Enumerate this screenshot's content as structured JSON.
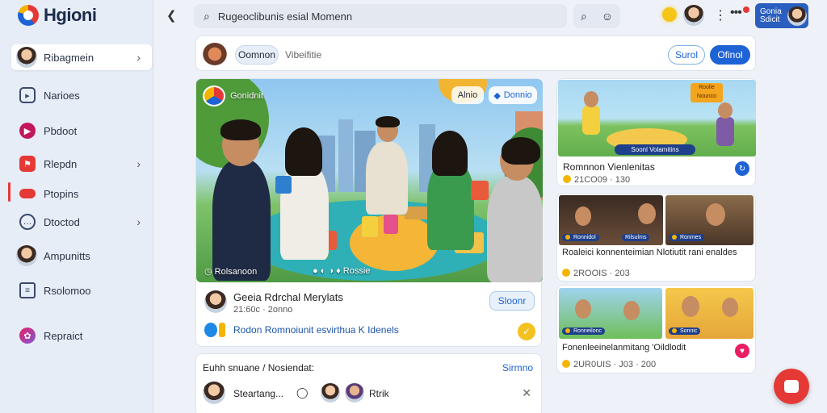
{
  "app": {
    "name": "Hgioni"
  },
  "sidebar": {
    "items": [
      {
        "label": "Ribagmein",
        "icon": "user-avatar-icon"
      },
      {
        "label": "Narioes",
        "icon": "nav-square-icon"
      },
      {
        "label": "Pbdoot",
        "icon": "play-icon"
      },
      {
        "label": "Rlepdn",
        "icon": "flag-icon"
      },
      {
        "label": "Ptopins",
        "icon": "pill-icon"
      },
      {
        "label": "Dtoctod",
        "icon": "chat-bubble-icon"
      },
      {
        "label": "Ampunitts",
        "icon": "user-avatar-icon"
      },
      {
        "label": "Rsolomoo",
        "icon": "list-icon"
      },
      {
        "label": "Repraict",
        "icon": "puzzle-icon"
      }
    ]
  },
  "topbar": {
    "search_text": "Rugeoclibunis esial Momenn",
    "profile_label": "Gonia Sdicit"
  },
  "composer": {
    "chip_label": "Oomnon",
    "placeholder": "Vibeifitie",
    "btn_secondary": "Surol",
    "btn_primary": "Ofinol"
  },
  "main_post": {
    "group_label": "Gonidnit",
    "tag_secondary": "Alnio",
    "tag_primary": "Donnio",
    "caption_left": "Rolsanoon",
    "caption_right": "Rossie",
    "author": "Geeia Rdrchal Merylats",
    "time": "21:60c · 2onno",
    "follow_label": "Sloonr",
    "link_text": "Rodon Romnoiunit esvirthua K Idenels"
  },
  "comment_card": {
    "title": "Euhh snuane / Nosiendat:",
    "see_all": "Sirmno",
    "commenter": "Steartang...",
    "reply": "Rtrik"
  },
  "right_posts": [
    {
      "banner": "Soonl Volamitins",
      "badge_top": "Roolie Nounco",
      "title": "Romnnon Vienlenitas",
      "meta": "21CO09 · 130"
    },
    {
      "thumb1": "Ronnidol",
      "thumb2": "Rilsulms",
      "thumb3": "Ronmes",
      "title": "Roaleici konnenteimian Nlotiutit rani enaldes",
      "meta": "2ROOIS · 203"
    },
    {
      "thumb1": "Ronneilonc",
      "thumb2": "Sonnic",
      "title": "Fonenleeinelanmitang 'Oildlodit",
      "meta": "2UR0UIS · J03 · 200"
    }
  ],
  "colors": {
    "accent": "#1e63d6",
    "brand_red": "#e53935",
    "sidebar_bg": "#e7edf7"
  }
}
